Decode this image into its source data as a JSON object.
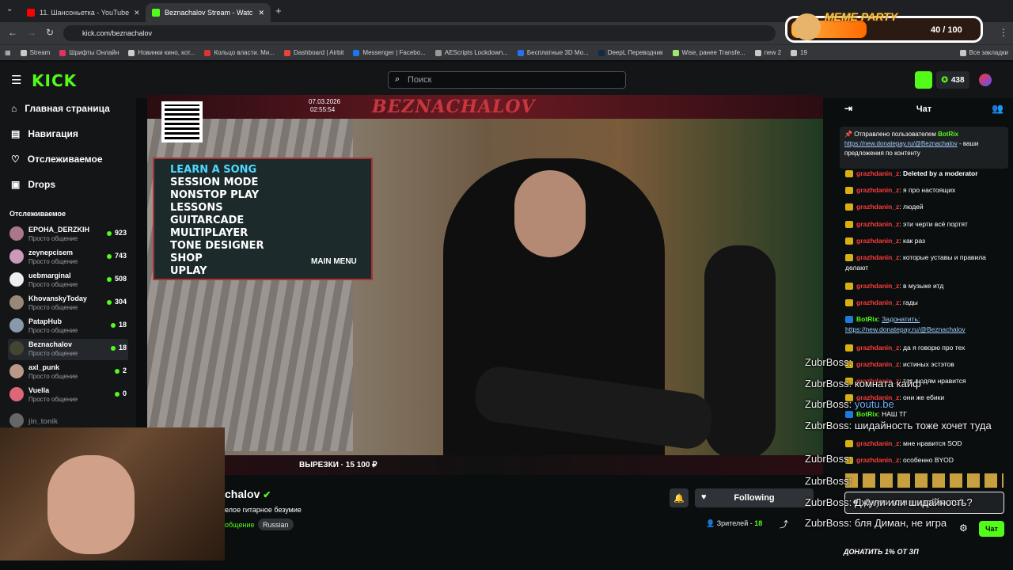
{
  "browser": {
    "tabs": [
      {
        "label": "11. Шансоньетка - YouTube",
        "color": "#ff0000"
      },
      {
        "label": "Beznachalov Stream - Watc",
        "color": "#53fc18"
      }
    ],
    "url": "kick.com/beznachalov",
    "bookmarks": [
      "Stream",
      "Шрифты Онлайн",
      "Новинки кино, кот...",
      "Кольцо власти. Ми...",
      "Dashboard | Airbit",
      "Messenger | Facebo...",
      "AEScripts Lockdown...",
      "Бесплатные 3D Мо...",
      "DeepL Переводчик",
      "Wise, ранее Transfe...",
      "new 2",
      "19"
    ],
    "all_bookmarks": "Все закладки"
  },
  "header": {
    "logo": "KICK",
    "search_placeholder": "Поиск",
    "points": "438"
  },
  "sidebar": {
    "nav": [
      "Главная страница",
      "Навигация",
      "Отслеживаемое",
      "Drops"
    ],
    "section_title": "Отслеживаемое",
    "channels": [
      {
        "name": "EPOHA_DERZKIH",
        "category": "Просто общение",
        "viewers": "923"
      },
      {
        "name": "zeynepcisem",
        "category": "Просто общение",
        "viewers": "743"
      },
      {
        "name": "uebmarginal",
        "category": "Просто общение",
        "viewers": "508"
      },
      {
        "name": "KhovanskyToday",
        "category": "Просто общение",
        "viewers": "304"
      },
      {
        "name": "PatapHub",
        "category": "Просто общение",
        "viewers": "18"
      },
      {
        "name": "Beznachalov",
        "category": "Просто общение",
        "viewers": "18"
      },
      {
        "name": "axl_punk",
        "category": "Просто общение",
        "viewers": "2"
      },
      {
        "name": "Vuella",
        "category": "Просто общение",
        "viewers": "0"
      }
    ],
    "offline_channel": "jin_tonik"
  },
  "stream": {
    "banner": "BEZNACHALOV",
    "overlay_date": "07.03.2026",
    "overlay_time": "02:55:54",
    "menu_items": [
      "LEARN A SONG",
      "SESSION MODE",
      "NONSTOP PLAY",
      "LESSONS",
      "GUITARCADE",
      "MULTIPLAYER",
      "TONE DESIGNER",
      "SHOP",
      "UPLAY"
    ],
    "menu_footer": "MAIN MENU",
    "goal": "ВЫРЕЗКИ · 15 100 ₽",
    "channel_name": "chalov",
    "title": "елое гитарное безумие",
    "category": "общение",
    "language": "Russian",
    "follow_label": "Following",
    "viewers_label": "Зрителей",
    "viewers": "18"
  },
  "chat": {
    "header": "Чат",
    "pinned_by": "Отправлено пользователем",
    "pinned_user": "BotRix",
    "pinned_link": "https://new.donatepay.ru/@Beznachalov",
    "pinned_text": " - ваши предложения по контенту",
    "messages": [
      {
        "user": "grazhdanin_z",
        "text": "Deleted by a moderator"
      },
      {
        "user": "grazhdanin_z",
        "text": "я про настоящих"
      },
      {
        "user": "grazhdanin_z",
        "text": "людей"
      },
      {
        "user": "grazhdanin_z",
        "text": "эти черти всё портят"
      },
      {
        "user": "grazhdanin_z",
        "text": "как раз"
      },
      {
        "user": "grazhdanin_z",
        "text": "которые уставы и правила делают"
      },
      {
        "user": "grazhdanin_z",
        "text": "в музыке итд"
      },
      {
        "user": "grazhdanin_z",
        "text": "гады"
      },
      {
        "user": "BotRix",
        "text": "Задонатить: https://new.donatepay.ru/@Beznachalov"
      },
      {
        "user": "grazhdanin_z",
        "text": "да я говорю про тех"
      },
      {
        "user": "grazhdanin_z",
        "text": "истиных эстэтов"
      },
      {
        "user": "grazhdanin_z",
        "text": "так людям нравится"
      },
      {
        "user": "grazhdanin_z",
        "text": "они же ебики"
      },
      {
        "user": "BotRix",
        "text": "НАШ ТГ"
      },
      {
        "user": "grazhdanin_z",
        "text": "мне нравится SOD"
      },
      {
        "user": "grazhdanin_z",
        "text": "особенно BYOD"
      }
    ],
    "input_text": "Джули или шидайность?",
    "send_label": "Чат",
    "footer": "ДОНАТИТЬ 1% ОТ ЗП"
  },
  "overlay_chat": [
    {
      "user": "ZubrBoss:",
      "text": ""
    },
    {
      "user": "ZubrBoss:",
      "text": "комната кайф"
    },
    {
      "user": "ZubrBoss:",
      "text": "youtu.be"
    },
    {
      "user": "ZubrBoss:",
      "text": "шидайность тоже хочет туда"
    },
    {
      "user": "ZubrBoss:",
      "text": ""
    },
    {
      "user": "ZubrBoss:",
      "text": ""
    },
    {
      "user": "ZubrBoss:",
      "text": "Джули или шидайность?"
    },
    {
      "user": "ZubrBoss:",
      "text": "бля Диман, не игра"
    }
  ],
  "meme_party": {
    "title": "MEME PARTY",
    "count": "40 / 100"
  }
}
